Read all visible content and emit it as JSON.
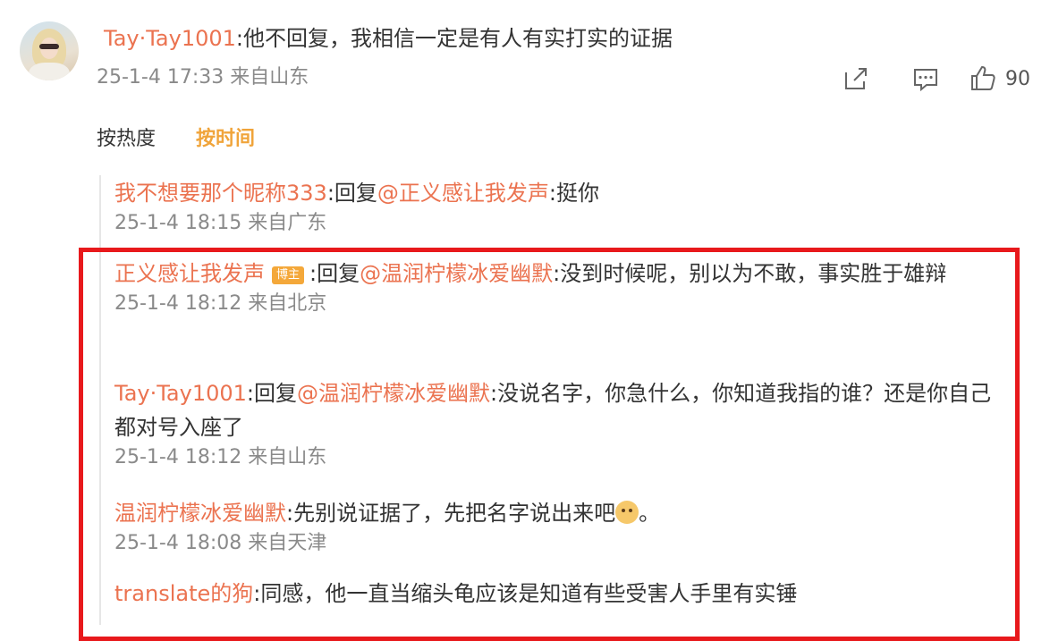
{
  "main_comment": {
    "user": "Tay·Tay1001",
    "text": ":他不回复，我相信一定是有人有实打实的证据",
    "time": "25-1-4 17:33",
    "location": "来自山东",
    "like_count": "90"
  },
  "sort_tabs": {
    "hot": "按热度",
    "time": "按时间",
    "active": "time"
  },
  "replies": [
    {
      "user": "我不想要那个昵称333",
      "reply_prefix": ":回复",
      "mention": "@正义感让我发声",
      "text": ":挺你",
      "time": "25-1-4 18:15",
      "location": "来自广东"
    },
    {
      "user": "正义感让我发声",
      "badge": "博主",
      "reply_prefix": ":回复",
      "mention": "@温润柠檬冰爱幽默",
      "text": ":没到时候呢，别以为不敢，事实胜于雄辩",
      "time": "25-1-4 18:12",
      "location": "来自北京"
    },
    {
      "user": "Tay·Tay1001",
      "reply_prefix": ":回复",
      "mention": "@温润柠檬冰爱幽默",
      "text": ":没说名字，你急什么，你知道我指的谁？还是你自己都对号入座了",
      "time": "25-1-4 18:12",
      "location": "来自山东"
    },
    {
      "user": "温润柠檬冰爱幽默",
      "text": ":先别说证据了，先把名字说出来吧",
      "text_end": "。",
      "time": "25-1-4 18:08",
      "location": "来自天津"
    },
    {
      "user": "translate的狗",
      "text": ":同感，他一直当缩头龟应该是知道有些受害人手里有实锤"
    }
  ],
  "icons": {
    "share": "share-icon",
    "comment": "comment-icon",
    "like": "thumbs-up-icon"
  },
  "colors": {
    "username": "#eb7350",
    "meta": "#8a8a8a",
    "active_tab": "#f0a43a",
    "highlight_border": "#e8191c",
    "badge": "#f4a83a"
  }
}
